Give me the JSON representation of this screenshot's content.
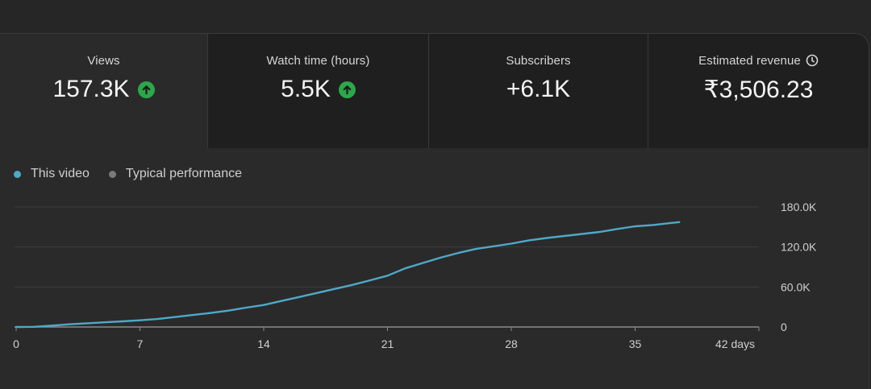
{
  "metrics": [
    {
      "label": "Views",
      "value": "157.3K",
      "trend_icon": "arrow-up-icon",
      "active": true
    },
    {
      "label": "Watch time (hours)",
      "value": "5.5K",
      "trend_icon": "arrow-up-icon",
      "active": false
    },
    {
      "label": "Subscribers",
      "value": "+6.1K",
      "trend_icon": null,
      "active": false
    },
    {
      "label": "Estimated revenue",
      "value": "₹3,506.23",
      "trend_icon": null,
      "info_icon": "clock-icon",
      "active": false
    }
  ],
  "colors": {
    "series": "#4ea9c8",
    "typical": "#7a7a7a",
    "trend_up": "#2ba84a"
  },
  "chart_data": {
    "type": "line",
    "legend": [
      "This video",
      "Typical performance"
    ],
    "x_unit": "days",
    "xlim": [
      0,
      42
    ],
    "ylim": [
      0,
      180000
    ],
    "x_ticks": [
      0,
      7,
      14,
      21,
      28,
      35,
      42
    ],
    "x_tick_labels": [
      "0",
      "7",
      "14",
      "21",
      "28",
      "35",
      "42 days"
    ],
    "y_ticks": [
      0,
      60000,
      120000,
      180000
    ],
    "y_tick_labels": [
      "0",
      "60.0K",
      "120.0K",
      "180.0K"
    ],
    "grid": true,
    "series": [
      {
        "name": "This video",
        "x": [
          0,
          1,
          2,
          3,
          4,
          5,
          6,
          7,
          8,
          9,
          10,
          11,
          12,
          13,
          14,
          15,
          16,
          17,
          18,
          19,
          20,
          21,
          22,
          23,
          24,
          25,
          26,
          27,
          28,
          29,
          30,
          31,
          32,
          33,
          34,
          35,
          36,
          37,
          37.5
        ],
        "values": [
          0,
          300,
          2000,
          4000,
          5500,
          7000,
          8500,
          10000,
          12000,
          15000,
          18000,
          21000,
          24500,
          29000,
          33000,
          39000,
          45000,
          51000,
          57000,
          63000,
          70000,
          77000,
          88000,
          96000,
          104000,
          111000,
          117000,
          121000,
          125000,
          130000,
          133500,
          136500,
          139500,
          142500,
          147000,
          151000,
          153000,
          156000,
          157300
        ]
      }
    ]
  }
}
